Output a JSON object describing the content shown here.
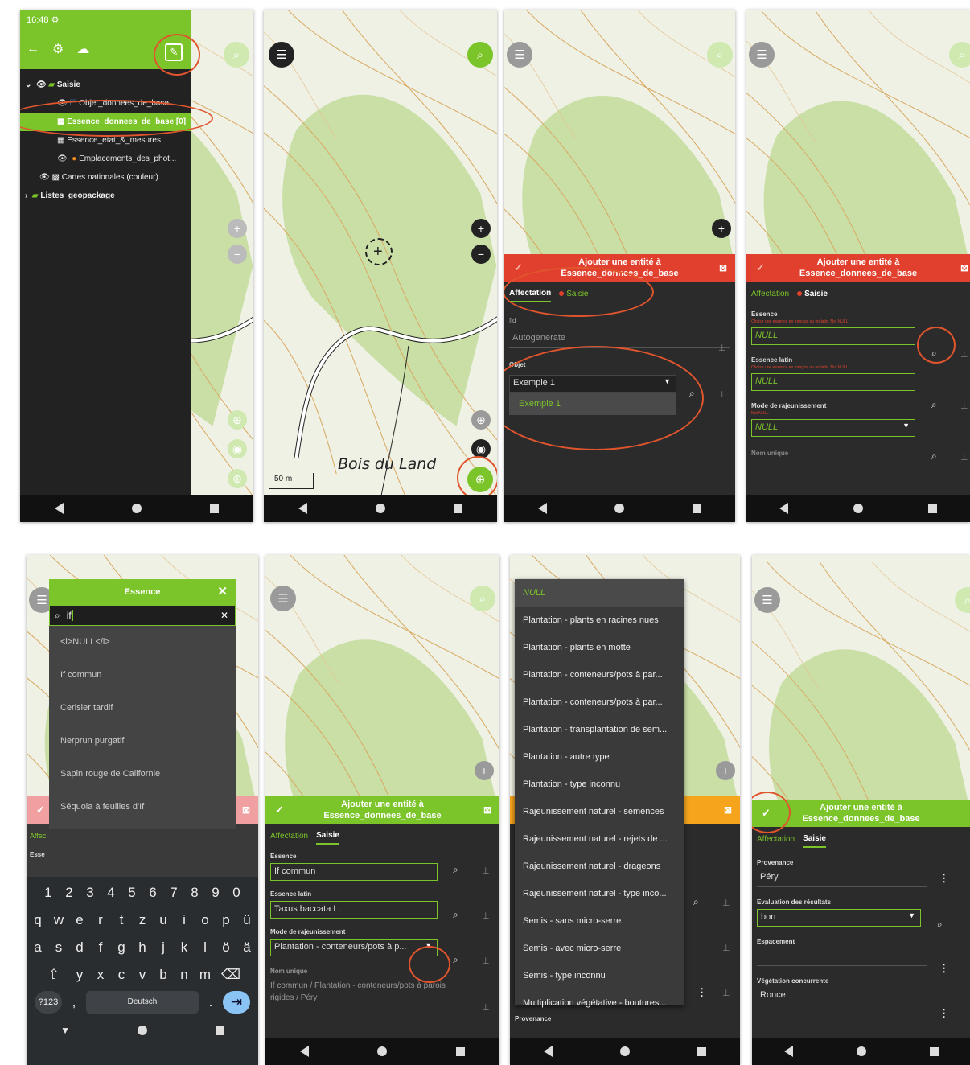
{
  "p1": {
    "time": "16:48",
    "layers": [
      {
        "label": "Saisie"
      },
      {
        "label": "Objet_donnees_de_base"
      },
      {
        "label": "Essence_donnees_de_base [0]"
      },
      {
        "label": "Essence_etat_&_mesures"
      },
      {
        "label": "Emplacements_des_phot..."
      },
      {
        "label": "Cartes nationales (couleur)"
      },
      {
        "label": "Listes_geopackage"
      }
    ]
  },
  "p2": {
    "place_name": "Bois du Land",
    "scale": "50 m"
  },
  "p3": {
    "form_title": "Ajouter une entité à Essence_donnees_de_base",
    "tab_affectation": "Affectation",
    "tab_saisie": "Saisie",
    "fid_label": "fid",
    "fid_value": "Autogenerate",
    "objet_label": "Objet",
    "objet_value": "Exemple 1",
    "objet_option": "Exemple 1"
  },
  "p4": {
    "form_title": "Ajouter une entité à Essence_donnees_de_base",
    "tab_affectation": "Affectation",
    "tab_saisie": "Saisie",
    "essence_label": "Essence",
    "essence_hint": "Choisir une essence en français ou en latin. Not NULL",
    "essence_value": "NULL",
    "latin_label": "Essence latin",
    "latin_hint": "Choisir une essence en français ou en latin. Not NULL",
    "latin_value": "NULL",
    "mode_label": "Mode de rajeunissement",
    "mode_hint": "Not NULL",
    "mode_value": "NULL",
    "nom_label": "Nom unique"
  },
  "p5": {
    "dialog_title": "Essence",
    "search_value": "if",
    "results": [
      "<i>NULL</i>",
      "If commun",
      "Cerisier tardif",
      "Nerprun purgatif",
      "Sapin rouge de Californie",
      "Séquoia à feuilles d'If"
    ],
    "bg_affectation": "Affec",
    "bg_essence": "Esse",
    "kbd_row_numbers": [
      "1",
      "2",
      "3",
      "4",
      "5",
      "6",
      "7",
      "8",
      "9",
      "0"
    ],
    "kbd_row1": [
      "q",
      "w",
      "e",
      "r",
      "t",
      "z",
      "u",
      "i",
      "o",
      "p",
      "ü"
    ],
    "kbd_row2": [
      "a",
      "s",
      "d",
      "f",
      "g",
      "h",
      "j",
      "k",
      "l",
      "ö",
      "ä"
    ],
    "kbd_row3": [
      "y",
      "x",
      "c",
      "v",
      "b",
      "n",
      "m"
    ],
    "kbd_symbols": "?123",
    "kbd_comma": ",",
    "kbd_space": "Deutsch",
    "kbd_period": "."
  },
  "p6": {
    "form_title": "Ajouter une entité à Essence_donnees_de_base",
    "tab_affectation": "Affectation",
    "tab_saisie": "Saisie",
    "essence_label": "Essence",
    "essence_value": "If commun",
    "latin_label": "Essence latin",
    "latin_value": "Taxus baccata L.",
    "mode_label": "Mode de rajeunissement",
    "mode_value": "Plantation - conteneurs/pots à p...",
    "nom_label": "Nom unique",
    "nom_value": "If commun / Plantation - conteneurs/pots à parois rigides / Péry"
  },
  "p7": {
    "options": [
      "NULL",
      "Plantation - plants en racines nues",
      "Plantation - plants en motte",
      "Plantation - conteneurs/pots à par...",
      "Plantation - conteneurs/pots à par...",
      "Plantation - transplantation de sem...",
      "Plantation - autre type",
      "Plantation - type inconnu",
      "Rajeunissement naturel - semences",
      "Rajeunissement naturel - rejets de ...",
      "Rajeunissement naturel - drageons",
      "Rajeunissement naturel - type inco...",
      "Semis - sans micro-serre",
      "Semis - avec micro-serre",
      "Semis - type inconnu",
      "Multiplication végétative - boutures..."
    ],
    "bg_provenance": "Provenance"
  },
  "p8": {
    "form_title": "Ajouter une entité à Essence_donnees_de_base",
    "tab_affectation": "Affectation",
    "tab_saisie": "Saisie",
    "prov_label": "Provenance",
    "prov_value": "Péry",
    "eval_label": "Evaluation des résultats",
    "eval_value": "bon",
    "esp_label": "Espacement",
    "esp_value": "",
    "veg_label": "Végétation concurrente",
    "veg_value": "Ronce"
  },
  "colors": {
    "accent": "#7bc42a",
    "danger": "#e0402d",
    "highlight": "#e0552d",
    "dark": "#2b2b2b"
  }
}
